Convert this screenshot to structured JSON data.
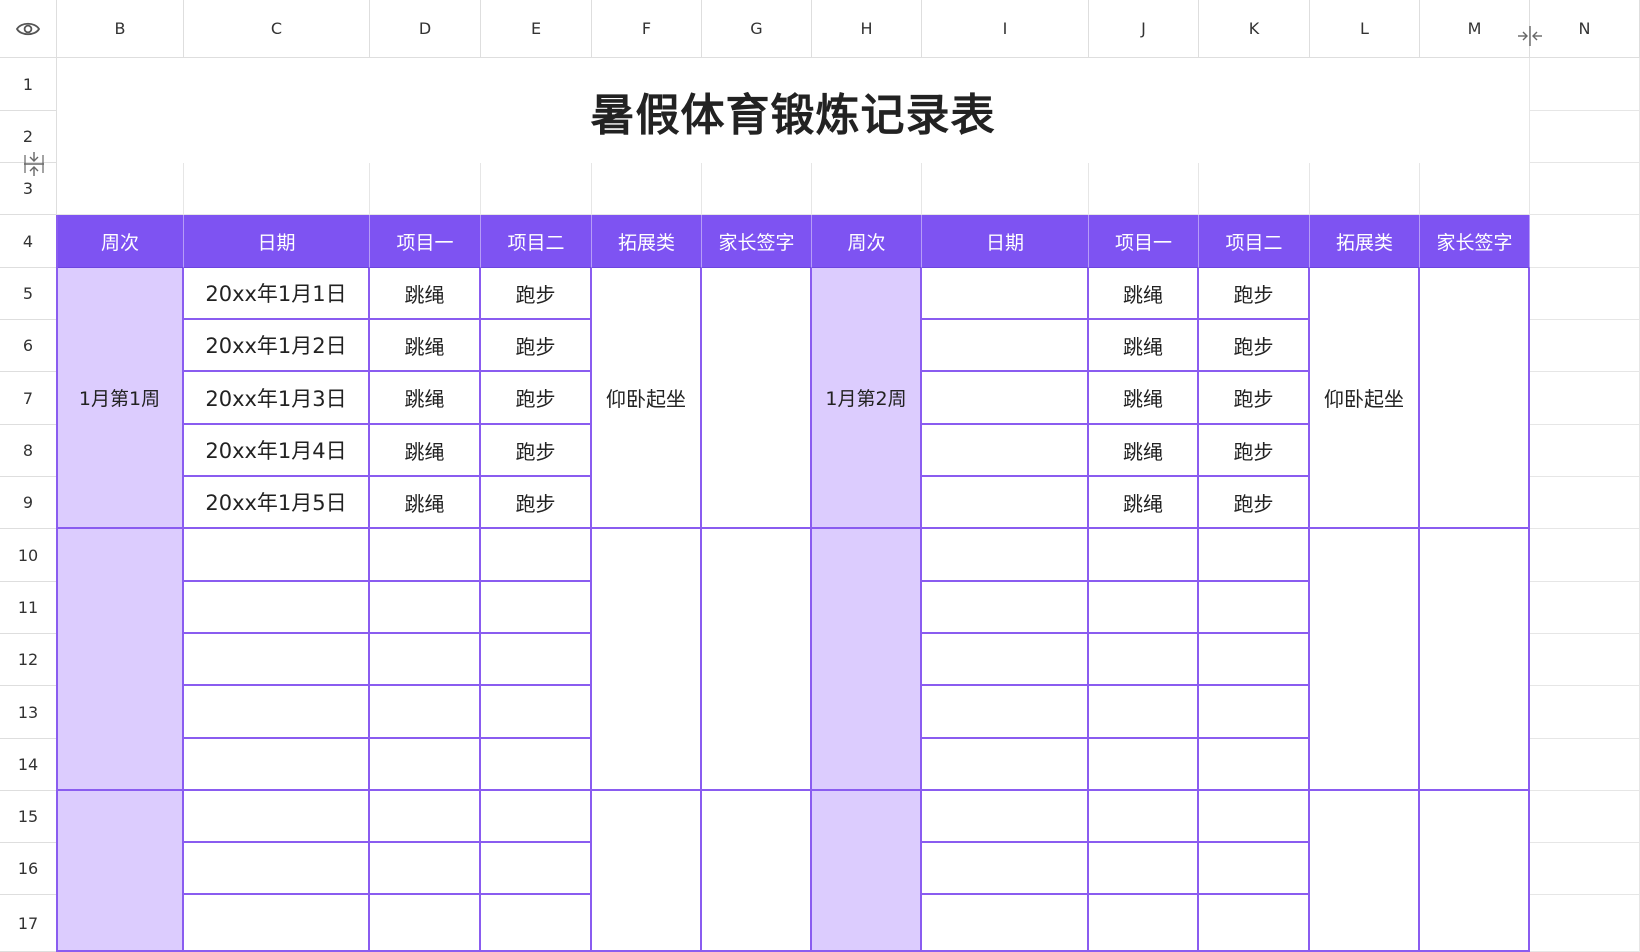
{
  "columns": [
    "B",
    "C",
    "D",
    "E",
    "F",
    "G",
    "H",
    "I",
    "J",
    "K",
    "L",
    "M",
    "N"
  ],
  "rows": [
    "1",
    "2",
    "3",
    "4",
    "5",
    "6",
    "7",
    "8",
    "9",
    "10",
    "11",
    "12",
    "13",
    "14",
    "15",
    "16",
    "17"
  ],
  "icons": {
    "visibility": "eye-icon",
    "column_resize": "column-resize-icon",
    "row_resize": "row-resize-icon"
  },
  "colors": {
    "header_bg": "#7e53f2",
    "week_bg": "#dcccfe",
    "border": "#8a5cf0"
  },
  "sheet": {
    "title": "暑假体育锻炼记录表",
    "headers": [
      "周次",
      "日期",
      "项目一",
      "项目二",
      "拓展类",
      "家长签字",
      "周次",
      "日期",
      "项目一",
      "项目二",
      "拓展类",
      "家长签字"
    ],
    "left_block": {
      "week": "1月第1周",
      "extension": "仰卧起坐",
      "dates": [
        "20xx年1月1日",
        "20xx年1月2日",
        "20xx年1月3日",
        "20xx年1月4日",
        "20xx年1月5日"
      ],
      "item1": [
        "跳绳",
        "跳绳",
        "跳绳",
        "跳绳",
        "跳绳"
      ],
      "item2": [
        "跑步",
        "跑步",
        "跑步",
        "跑步",
        "跑步"
      ]
    },
    "right_block": {
      "week": "1月第2周",
      "extension": "仰卧起坐",
      "item1": [
        "跳绳",
        "跳绳",
        "跳绳",
        "跳绳",
        "跳绳"
      ],
      "item2": [
        "跑步",
        "跑步",
        "跑步",
        "跑步",
        "跑步"
      ]
    }
  }
}
